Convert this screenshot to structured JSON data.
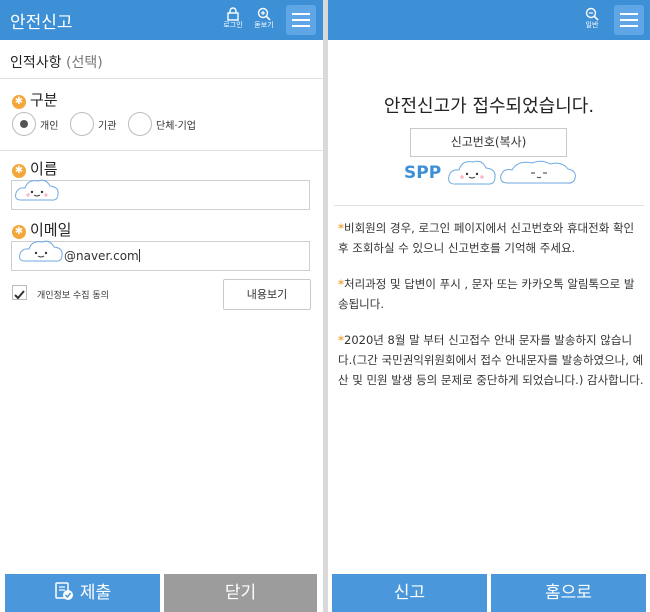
{
  "left": {
    "header": {
      "title": "안전신고",
      "login_label": "로그인",
      "zoom_label": "돋보기"
    },
    "section": {
      "title": "인적사항",
      "subtitle": "(선택)"
    },
    "type": {
      "label": "구분",
      "options": [
        "개인",
        "기관",
        "단체·기업"
      ],
      "selected": "개인"
    },
    "name": {
      "label": "이름",
      "value": ""
    },
    "email": {
      "label": "이메일",
      "value": "@naver.com"
    },
    "consent": {
      "label": "개인정보 수집 동의",
      "checked": true,
      "view_button": "내용보기"
    },
    "bottom": {
      "submit": "제출",
      "close": "닫기"
    }
  },
  "right": {
    "header": {
      "zoom_label": "일반"
    },
    "title": "안전신고가 접수되었습니다.",
    "copy_button": "신고번호(복사)",
    "report_number_prefix": "SPP",
    "notes": [
      "비회원의 경우, 로그인 페이지에서 신고번호와 휴대전화 확인 후 조회하실 수 있으니 신고번호를 기억해 주세요.",
      "처리과정 및 답변이 푸시 , 문자 또는 카카오톡 알림톡으로 발송됩니다.",
      "2020년 8월 말 부터 신고접수 안내 문자를 발송하지 않습니다.(그간 국민권익위원회에서 접수 안내문자를 발송하였으나, 예산 및 민원 발생 등의 문제로 중단하게 되었습니다.) 감사합니다."
    ],
    "bottom": {
      "report": "신고",
      "home": "홈으로"
    }
  },
  "colors": {
    "primary": "#3d8fd6",
    "menu": "#5fa6e6",
    "accent": "#f3a73b",
    "gray_button": "#9c9c9c"
  },
  "icons": [
    "lock-icon",
    "magnifier-icon",
    "hamburger-menu-icon",
    "submit-check-icon",
    "checkmark-icon",
    "cloud-sticker"
  ]
}
